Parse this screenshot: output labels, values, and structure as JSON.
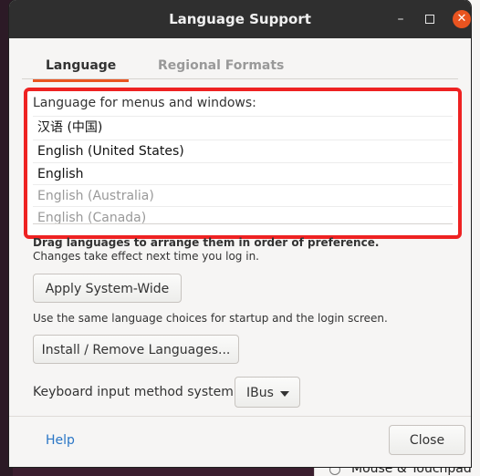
{
  "window": {
    "title": "Language Support",
    "controls": {
      "minimize": "–",
      "close": "✕"
    }
  },
  "tabs": [
    {
      "label": "Language",
      "active": true
    },
    {
      "label": "Regional Formats",
      "active": false
    }
  ],
  "language_list": {
    "header": "Language for menus and windows:",
    "items": [
      {
        "label": "汉语 (中国)",
        "enabled": true
      },
      {
        "label": "English (United States)",
        "enabled": true
      },
      {
        "label": "English",
        "enabled": true
      },
      {
        "label": "English (Australia)",
        "enabled": false
      },
      {
        "label": "English (Canada)",
        "enabled": false
      }
    ]
  },
  "hints": {
    "drag": "Drag languages to arrange them in order of preference.",
    "effect": "Changes take effect next time you log in.",
    "same_choices": "Use the same language choices for startup and the login screen."
  },
  "buttons": {
    "apply": "Apply System-Wide",
    "install": "Install / Remove Languages...",
    "help": "Help",
    "close": "Close"
  },
  "keyboard_input": {
    "label": "Keyboard input method system:",
    "selected": "IBus"
  },
  "background": {
    "settings_item": "Mouse & Touchpad"
  },
  "colors": {
    "accent": "#e95420",
    "highlight_border": "#ee2222",
    "link": "#2a76c6",
    "titlebar": "#2f2f2f"
  }
}
